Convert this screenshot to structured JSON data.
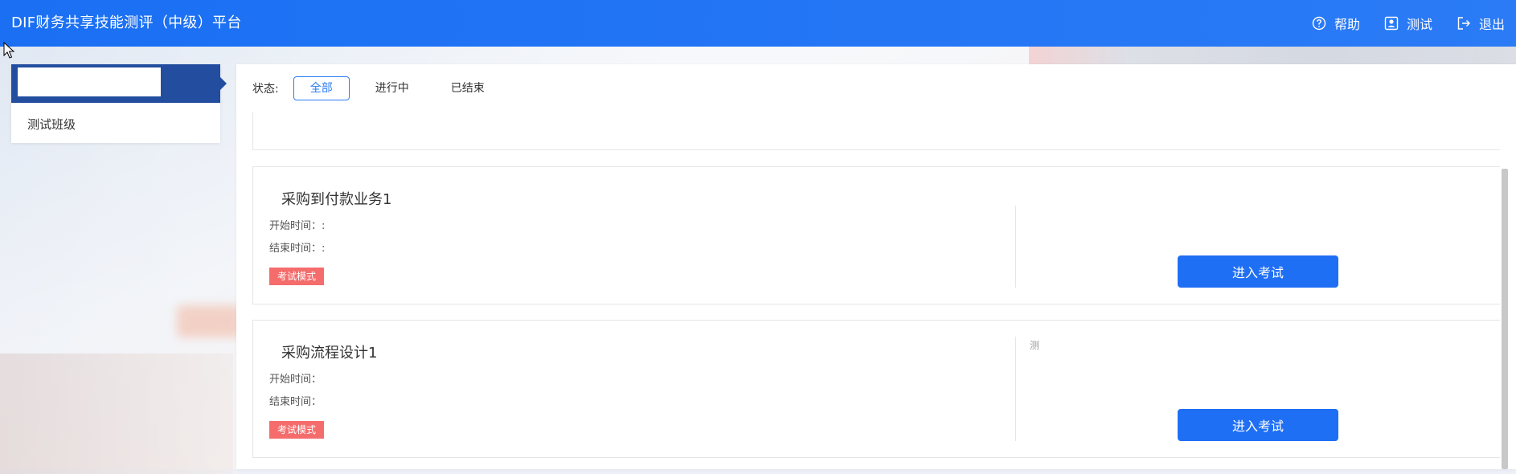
{
  "header": {
    "title": "DIF财务共享技能测评（中级）平台",
    "help_label": "帮助",
    "user_label": "测试",
    "logout_label": "退出"
  },
  "sidebar": {
    "items": [
      {
        "label": "测试班级"
      }
    ]
  },
  "filters": {
    "label": "状态:",
    "options": [
      "全部",
      "进行中",
      "已结束"
    ],
    "selected": "全部"
  },
  "cards": [
    {
      "title": "采购到付款业务1",
      "start_label": "开始时间：:",
      "end_label": "结束时间：:",
      "tag": "考试模式",
      "note": "",
      "button": "进入考试"
    },
    {
      "title": "采购流程设计1",
      "start_label": "开始时间：",
      "end_label": "结束时间：",
      "tag": "考试模式",
      "note": "测",
      "button": "进入考试"
    }
  ],
  "colors": {
    "header_blue": "#1a6ff3",
    "sidebar_selected": "#234e9f",
    "button_blue": "#1f6ff4",
    "tag_red": "#f56c6c"
  }
}
